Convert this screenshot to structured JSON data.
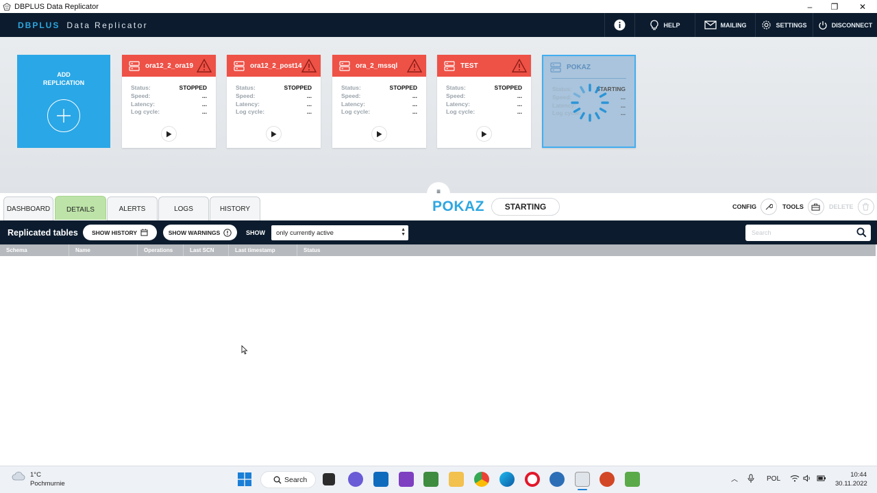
{
  "window": {
    "title": "DBPLUS Data Replicator",
    "controls": [
      "–",
      "❐",
      "✕"
    ]
  },
  "header": {
    "brand_a": "DBPLUS",
    "brand_b": "Data Replicator",
    "buttons": {
      "info": "i",
      "help": "HELP",
      "mailing": "MAILING",
      "settings": "SETTINGS",
      "disconnect": "DISCONNECT"
    }
  },
  "add_tile": {
    "label": "ADD REPLICATION"
  },
  "replications": [
    {
      "name": "ora12_2_ora19",
      "status_label": "Status:",
      "status": "STOPPED",
      "speed_label": "Speed:",
      "speed": "...",
      "latency_label": "Latency:",
      "latency": "...",
      "logcycle_label": "Log cycle:",
      "logcycle": "..."
    },
    {
      "name": "ora12_2_post14",
      "status_label": "Status:",
      "status": "STOPPED",
      "speed_label": "Speed:",
      "speed": "...",
      "latency_label": "Latency:",
      "latency": "...",
      "logcycle_label": "Log cycle:",
      "logcycle": "..."
    },
    {
      "name": "ora_2_mssql",
      "status_label": "Status:",
      "status": "STOPPED",
      "speed_label": "Speed:",
      "speed": "...",
      "latency_label": "Latency:",
      "latency": "...",
      "logcycle_label": "Log cycle:",
      "logcycle": "..."
    },
    {
      "name": "TEST",
      "status_label": "Status:",
      "status": "STOPPED",
      "speed_label": "Speed:",
      "speed": "...",
      "latency_label": "Latency:",
      "latency": "...",
      "logcycle_label": "Log cycle:",
      "logcycle": "..."
    },
    {
      "name": "POKAZ",
      "status_label": "Status:",
      "status": "STARTING",
      "speed_label": "Speed:",
      "speed": "...",
      "latency_label": "Latency:",
      "latency": "...",
      "logcycle_label": "Log cycle:",
      "logcycle": "..."
    }
  ],
  "collapse_glyph": "≡",
  "tabs": [
    "DASHBOARD",
    "DETAILS",
    "ALERTS",
    "LOGS",
    "HISTORY"
  ],
  "active_tab": "DETAILS",
  "selected": {
    "name": "POKAZ",
    "state": "STARTING"
  },
  "tools": {
    "config": "CONFIG",
    "tools": "TOOLS",
    "delete": "DELETE"
  },
  "table_toolbar": {
    "title": "Replicated tables",
    "show_history": "SHOW HISTORY",
    "show_warnings": "SHOW WARNINGS",
    "show_label": "SHOW",
    "filter_value": "only currently active",
    "search_placeholder": "Search"
  },
  "columns": [
    "Schema",
    "Name",
    "Operations",
    "Last SCN",
    "Last timestamp",
    "Status"
  ],
  "taskbar": {
    "temperature": "1°C",
    "weather": "Pochmurnie",
    "search": "Search",
    "language": "POL",
    "time": "10:44",
    "date": "30.11.2022"
  },
  "colors": {
    "header_bg": "#0c1c2e",
    "accent_blue": "#2ea7e0",
    "tile_red": "#ee5146",
    "active_tab": "#bde3a8"
  }
}
